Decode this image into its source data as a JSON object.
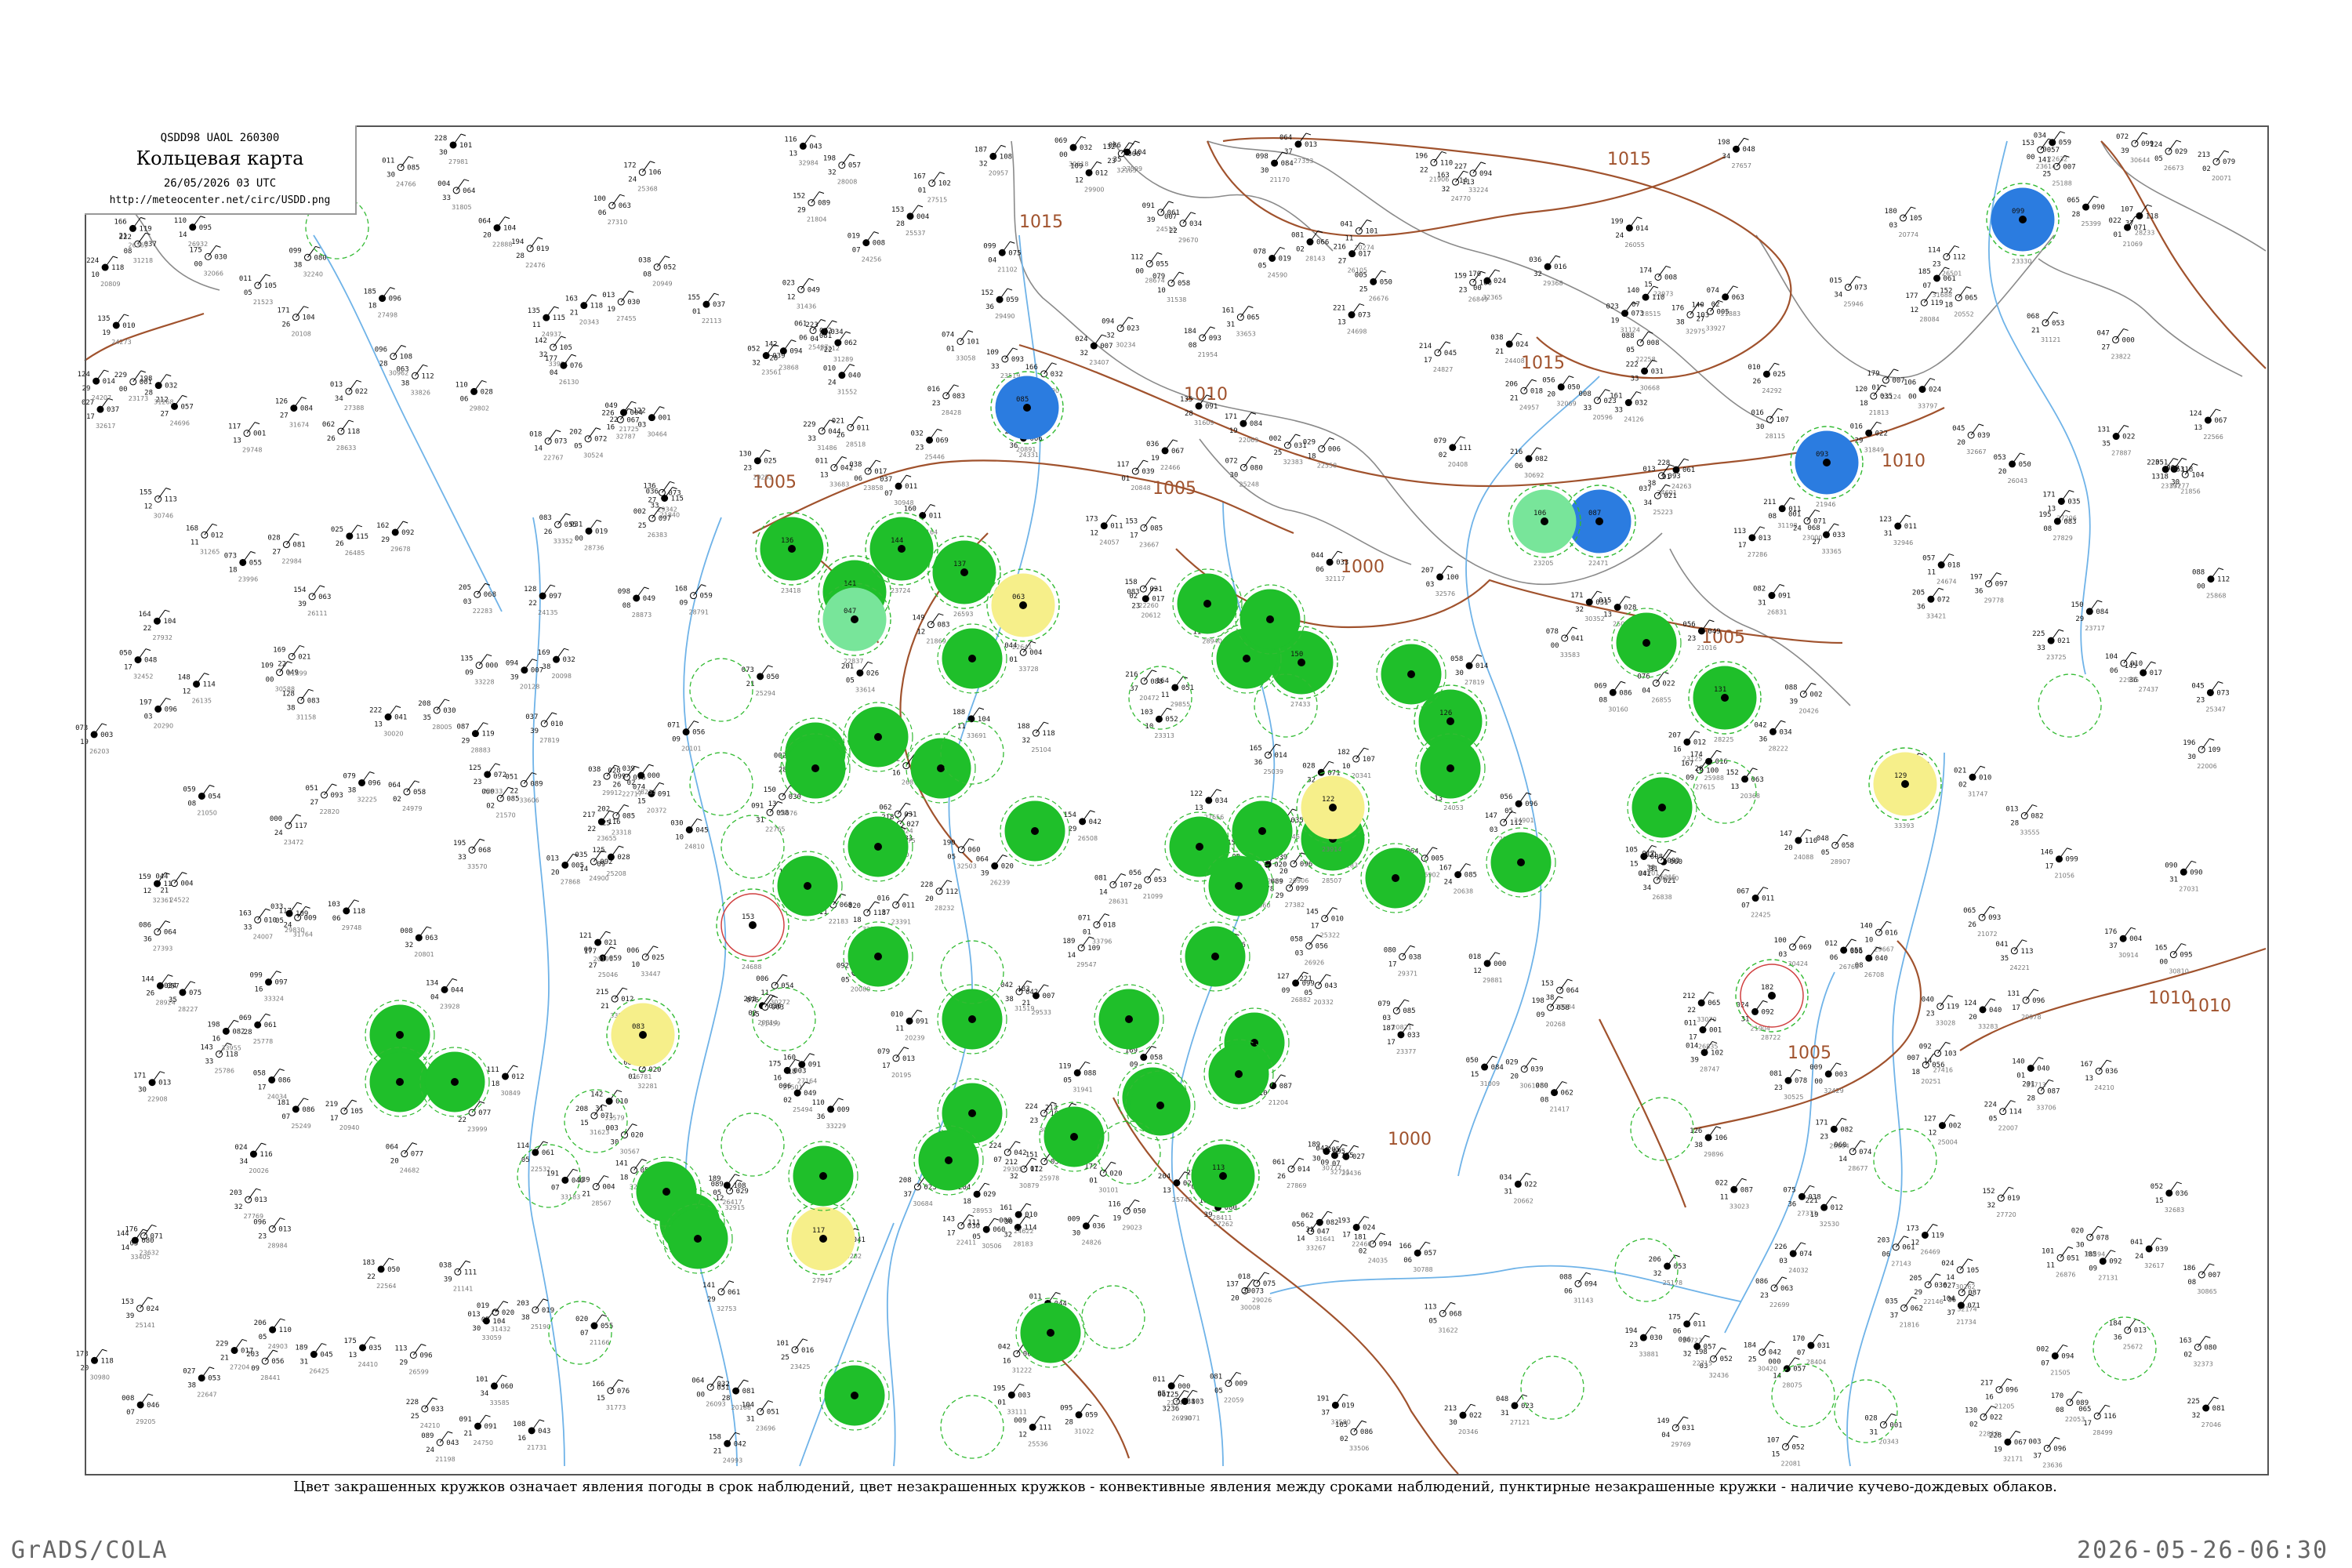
{
  "header": {
    "code": "QSDD98  UAOL  260300",
    "title": "Кольцевая карта",
    "date": "26/05/2026 03 UTC",
    "url": "http://meteocenter.net/circ/USDD.png"
  },
  "caption": "Цвет закрашенных кружков означает явления погоды в срок наблюдений, цвет незакрашенных кружков - конвективные явления между сроками наблюдений, пунктирные незакрашенные кружки - наличие кучево-дождевых облаков.",
  "footer": {
    "left": "GrADS/COLA",
    "right": "2026-05-26-06:30"
  },
  "colors": {
    "green": "#1fbf2a",
    "blue": "#2b7ce0",
    "yellow": "#f6ef8a",
    "mint": "#78e59a",
    "isobar": "#a0522d",
    "river": "#6fb3e8",
    "ring": "#33bb33"
  },
  "isobar_labels": [
    "1015",
    "1015",
    "1015",
    "1010",
    "1010",
    "1010",
    "1005",
    "1005",
    "1005",
    "1000",
    "1000",
    "1000",
    "1010",
    "1005"
  ],
  "stations": [
    {
      "kind": "green",
      "val": "136",
      "code": "23418"
    },
    {
      "kind": "green",
      "val": "141",
      "code": "23631"
    },
    {
      "kind": "green",
      "val": "144",
      "code": "23724"
    },
    {
      "kind": "green",
      "val": "137",
      "code": "26593"
    },
    {
      "kind": "green",
      "val": "150",
      "code": "27433"
    },
    {
      "kind": "green",
      "val": "126",
      "code": "27531"
    },
    {
      "kind": "green",
      "val": "131",
      "code": "28225"
    },
    {
      "kind": "green",
      "val": "113",
      "code": "28411"
    },
    {
      "kind": "green",
      "val": "127",
      "code": "28507"
    },
    {
      "kind": "blue",
      "val": "085",
      "code": "20891"
    },
    {
      "kind": "blue",
      "val": "099",
      "code": "23330"
    },
    {
      "kind": "blue",
      "val": "087",
      "code": "22471"
    },
    {
      "kind": "blue",
      "val": "093",
      "code": "21946"
    },
    {
      "kind": "yellow",
      "val": "063",
      "code": "22641"
    },
    {
      "kind": "yellow",
      "val": "122",
      "code": "23914"
    },
    {
      "kind": "yellow",
      "val": "083",
      "code": "26781"
    },
    {
      "kind": "yellow",
      "val": "117",
      "code": "27947"
    },
    {
      "kind": "yellow",
      "val": "129",
      "code": "33393"
    },
    {
      "kind": "mint",
      "val": "047",
      "code": "22837"
    },
    {
      "kind": "mint",
      "val": "106",
      "code": "23205"
    },
    {
      "kind": "ring",
      "val": "153",
      "code": "24688"
    },
    {
      "kind": "ring",
      "val": "182",
      "code": "28722"
    }
  ]
}
